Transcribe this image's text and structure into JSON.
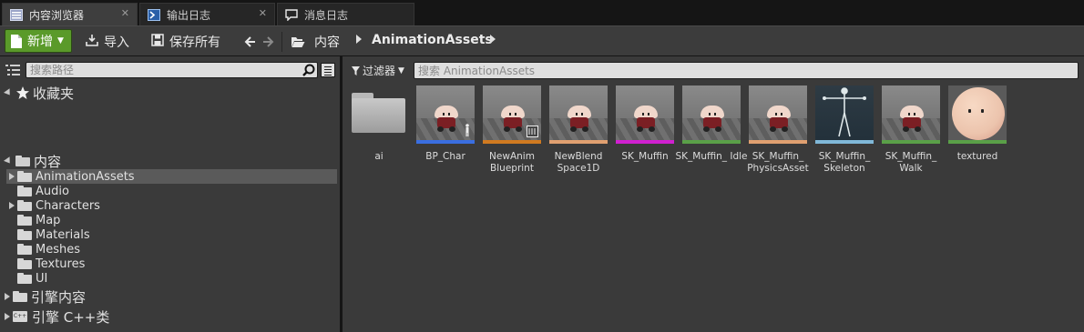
{
  "tabs": [
    {
      "label": "内容浏览器",
      "active": true,
      "close": "✕"
    },
    {
      "label": "输出日志",
      "active": false,
      "close": "✕"
    },
    {
      "label": "消息日志",
      "active": false,
      "close": ""
    }
  ],
  "toolbar": {
    "new_label": "新增",
    "import_label": "导入",
    "save_all_label": "保存所有",
    "breadcrumb": [
      "内容",
      "AnimationAssets"
    ]
  },
  "left": {
    "search_placeholder": "搜索路径",
    "favorites_label": "收藏夹",
    "root_label": "内容",
    "folders": [
      {
        "label": "AnimationAssets",
        "expandable": true,
        "selected": true
      },
      {
        "label": "Audio",
        "expandable": false,
        "selected": false
      },
      {
        "label": "Characters",
        "expandable": true,
        "selected": false
      },
      {
        "label": "Map",
        "expandable": false,
        "selected": false
      },
      {
        "label": "Materials",
        "expandable": false,
        "selected": false
      },
      {
        "label": "Meshes",
        "expandable": false,
        "selected": false
      },
      {
        "label": "Textures",
        "expandable": false,
        "selected": false
      },
      {
        "label": "UI",
        "expandable": false,
        "selected": false
      }
    ],
    "engine_content_label": "引擎内容",
    "engine_cpp_label": "引擎 C++类",
    "cpp_icon_text": "C++"
  },
  "right": {
    "filter_label": "过滤器",
    "search_placeholder": "搜索 AnimationAssets",
    "assets": [
      {
        "label": "ai",
        "kind": "folder",
        "strip_color": ""
      },
      {
        "label": "BP_Char",
        "kind": "muffin",
        "strip_color": "#3a6ee0"
      },
      {
        "label": "NewAnim Blueprint",
        "kind": "muffin",
        "strip_color": "#d07a20"
      },
      {
        "label": "NewBlend Space1D",
        "kind": "muffin",
        "strip_color": "#e0a070"
      },
      {
        "label": "SK_Muffin",
        "kind": "muffin",
        "strip_color": "#d020d0"
      },
      {
        "label": "SK_Muffin_ Idle",
        "kind": "muffin",
        "strip_color": "#5aa048"
      },
      {
        "label": "SK_Muffin_ PhysicsAsset",
        "kind": "muffin",
        "strip_color": "#e0a070"
      },
      {
        "label": "SK_Muffin_ Skeleton",
        "kind": "skeleton",
        "strip_color": "#80b8d8"
      },
      {
        "label": "SK_Muffin_ Walk",
        "kind": "muffin",
        "strip_color": "#5aa048"
      },
      {
        "label": "textured",
        "kind": "ball",
        "strip_color": "#5aa048"
      }
    ]
  },
  "colors": {
    "accent_green": "#5a9a2a",
    "panel": "#3a3a3a",
    "background": "#151515"
  }
}
